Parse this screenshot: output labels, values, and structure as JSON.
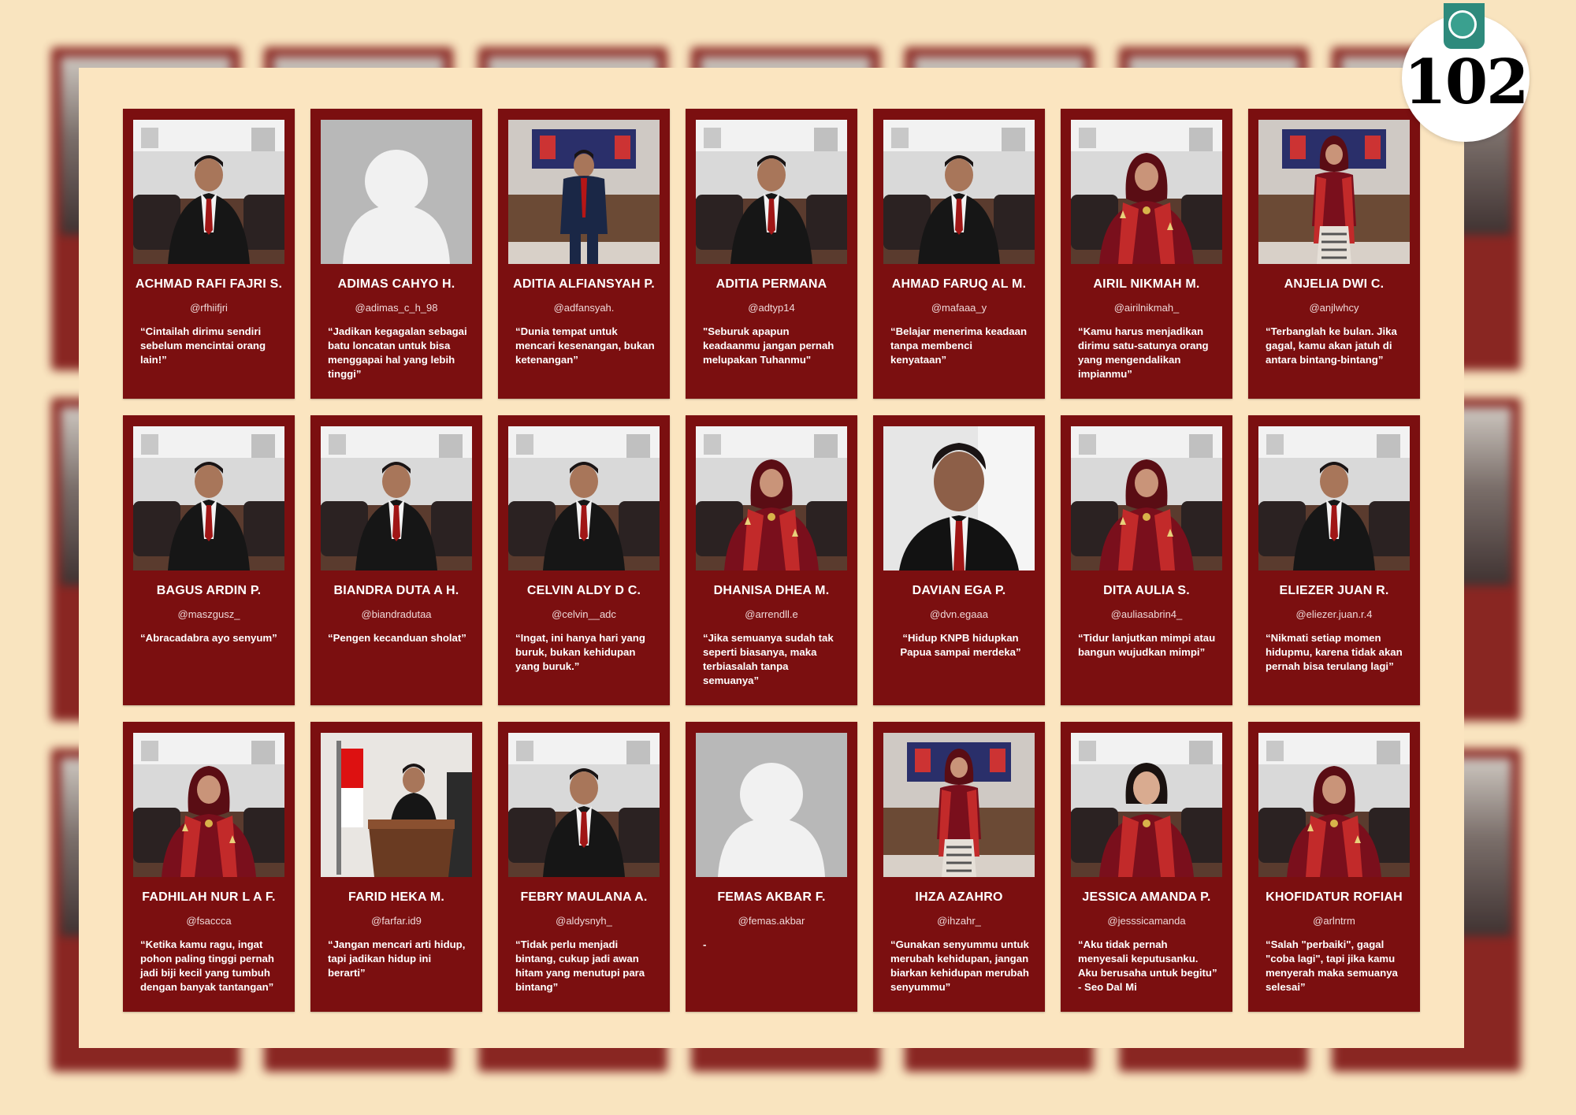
{
  "page_number": "102",
  "colors": {
    "background": "#f9e4bf",
    "card": "#7b0f10",
    "badge_accent": "#2e8a7c"
  },
  "students": [
    {
      "name": "ACHMAD RAFI FAJRI S.",
      "handle": "@rfhiifjri",
      "quote": "“Cintailah dirimu sendiri sebelum mencintai orang lain!”",
      "photo": "boy-suit"
    },
    {
      "name": "ADIMAS CAHYO H.",
      "handle": "@adimas_c_h_98",
      "quote": "“Jadikan kegagalan sebagai batu loncatan untuk bisa menggapai hal yang lebih tinggi”",
      "photo": "placeholder"
    },
    {
      "name": "ADITIA ALFIANSYAH P.",
      "handle": "@adfansyah.",
      "quote": "“Dunia tempat untuk mencari kesenangan, bukan ketenangan”",
      "photo": "boy-standing"
    },
    {
      "name": "ADITIA PERMANA",
      "handle": "@adtyp14",
      "quote": "\"Seburuk apapun keadaanmu jangan pernah melupakan Tuhanmu\"",
      "photo": "boy-suit"
    },
    {
      "name": "AHMAD FARUQ AL M.",
      "handle": "@mafaaa_y",
      "quote": "“Belajar menerima keadaan tanpa membenci kenyataan”",
      "photo": "boy-suit"
    },
    {
      "name": "AIRIL NIKMAH M.",
      "handle": "@airilnikmah_",
      "quote": "“Kamu harus menjadikan dirimu satu-satunya orang yang mengendalikan impianmu”",
      "photo": "girl-hijab"
    },
    {
      "name": "ANJELIA DWI C.",
      "handle": "@anjlwhcy",
      "quote": "“Terbanglah ke bulan. Jika gagal, kamu akan jatuh di antara bintang-bintang”",
      "photo": "girl-standing"
    },
    {
      "name": "BAGUS ARDIN P.",
      "handle": "@maszgusz_",
      "quote": "“Abracadabra ayo senyum”",
      "photo": "boy-suit"
    },
    {
      "name": "BIANDRA DUTA A H.",
      "handle": "@biandradutaa",
      "quote": "“Pengen kecanduan sholat”",
      "photo": "boy-suit"
    },
    {
      "name": "CELVIN ALDY D C.",
      "handle": "@celvin__adc",
      "quote": "“Ingat, ini hanya hari yang buruk, bukan kehidupan yang buruk.”",
      "photo": "boy-suit"
    },
    {
      "name": "DHANISA DHEA M.",
      "handle": "@arrendll.e",
      "quote": "“Jika semuanya sudah tak seperti biasanya, maka terbiasalah tanpa semuanya”",
      "photo": "girl-hijab"
    },
    {
      "name": "DAVIAN EGA P.",
      "handle": "@dvn.egaaa",
      "quote": "“Hidup KNPB hidupkan Papua sampai merdeka”",
      "photo": "boy-close"
    },
    {
      "name": "DITA AULIA S.",
      "handle": "@auliasabrin4_",
      "quote": "“Tidur lanjutkan mimpi atau bangun wujudkan mimpi”",
      "photo": "girl-hijab"
    },
    {
      "name": "ELIEZER JUAN R.",
      "handle": "@eliezer.juan.r.4",
      "quote": "“Nikmati setiap momen hidupmu, karena tidak akan pernah bisa terulang lagi”",
      "photo": "boy-suit"
    },
    {
      "name": "FADHILAH NUR L A F.",
      "handle": "@fsaccca",
      "quote": "“Ketika kamu ragu, ingat pohon paling tinggi pernah jadi biji kecil yang tumbuh dengan banyak tantangan”",
      "photo": "girl-hijab"
    },
    {
      "name": "FARID HEKA M.",
      "handle": "@farfar.id9",
      "quote": "“Jangan mencari arti hidup, tapi jadikan hidup ini berarti”",
      "photo": "boy-podium"
    },
    {
      "name": "FEBRY MAULANA A.",
      "handle": "@aldysnyh_",
      "quote": "“Tidak perlu menjadi bintang, cukup jadi awan hitam yang menutupi para bintang”",
      "photo": "boy-suit"
    },
    {
      "name": "FEMAS AKBAR F.",
      "handle": "@femas.akbar",
      "quote": "-",
      "photo": "placeholder"
    },
    {
      "name": "IHZA AZAHRO",
      "handle": "@ihzahr_",
      "quote": "“Gunakan senyummu untuk merubah kehidupan, jangan biarkan kehidupan merubah senyummu”",
      "photo": "girl-standing"
    },
    {
      "name": "JESSICA AMANDA P.",
      "handle": "@jesssicamanda",
      "quote": "“Aku tidak pernah menyesali keputusanku. Aku berusaha untuk begitu” - Seo Dal Mi",
      "photo": "girl-nohijab"
    },
    {
      "name": "KHOFIDATUR ROFIAH",
      "handle": "@arlntrm",
      "quote": "“Salah \"perbaiki\", gagal \"coba lagi\", tapi jika kamu menyerah maka semuanya selesai”",
      "photo": "girl-hijab"
    }
  ]
}
